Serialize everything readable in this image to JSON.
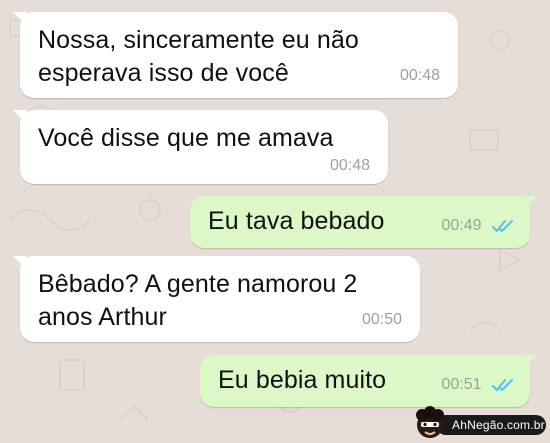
{
  "chat": {
    "background_color": "#e6ded6",
    "incoming_color": "#ffffff",
    "outgoing_color": "#dcf8c6",
    "read_receipt_color": "#4fc3f7",
    "messages": [
      {
        "direction": "incoming",
        "text": "Nossa, sinceramente eu não\nesperava isso de você",
        "time": "00:48"
      },
      {
        "direction": "incoming",
        "text": "Você disse que me amava",
        "time": "00:48"
      },
      {
        "direction": "outgoing",
        "text": "Eu tava bebado",
        "time": "00:49",
        "status": "double-check-read-icon"
      },
      {
        "direction": "incoming",
        "text": "Bêbado? A gente namorou 2\nanos Arthur",
        "time": "00:50"
      },
      {
        "direction": "outgoing",
        "text": "Eu bebia muito",
        "time": "00:51",
        "status": "double-check-read-icon"
      }
    ]
  },
  "watermark": {
    "text": "AhNegão.com.br"
  }
}
